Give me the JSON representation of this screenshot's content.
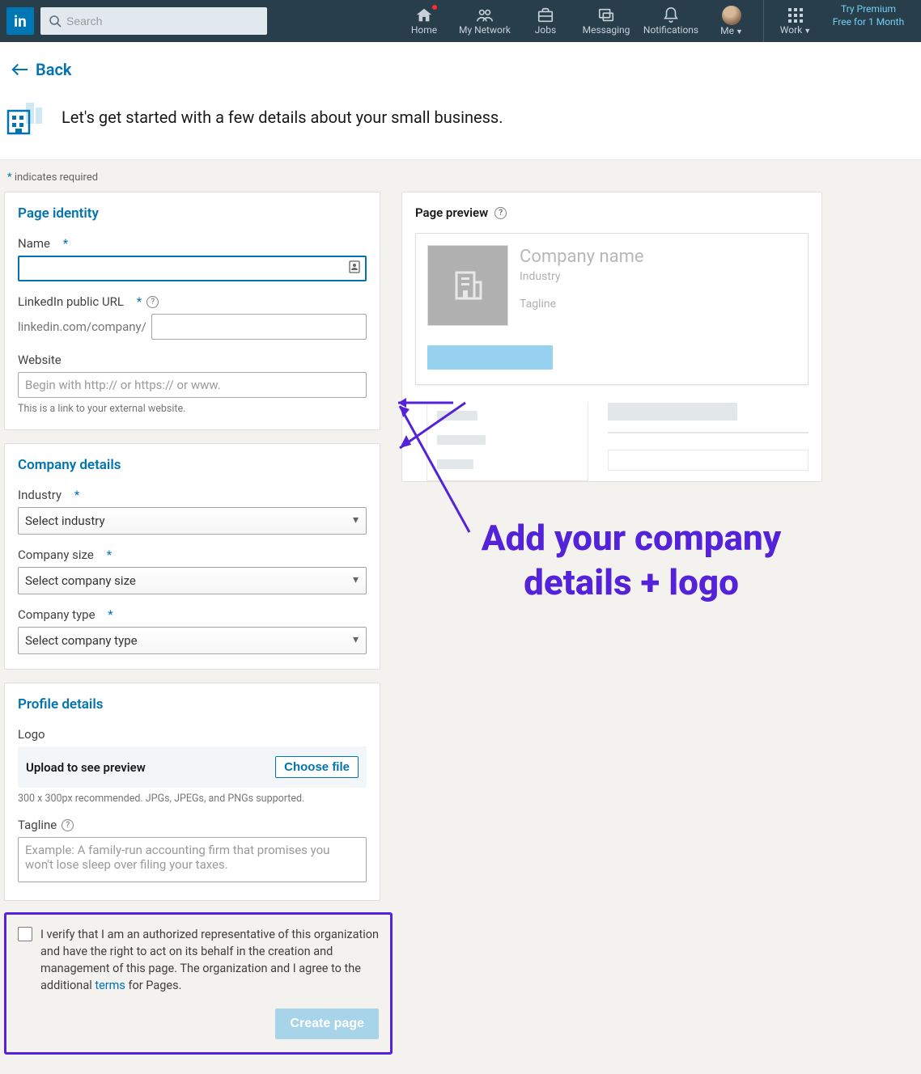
{
  "nav": {
    "logo_text": "in",
    "search_placeholder": "Search",
    "items": {
      "home": "Home",
      "network": "My Network",
      "jobs": "Jobs",
      "messaging": "Messaging",
      "notifications": "Notifications",
      "me": "Me",
      "work": "Work"
    },
    "premium_line1": "Try Premium",
    "premium_line2": "Free for 1 Month"
  },
  "back_label": "Back",
  "intro_text": "Let's get started with a few details about your small business.",
  "required_note": "indicates required",
  "required_mark": "*",
  "sections": {
    "identity": {
      "title": "Page identity",
      "name_label": "Name",
      "url_label": "LinkedIn public URL",
      "url_prefix": "linkedin.com/company/",
      "website_label": "Website",
      "website_placeholder": "Begin with http:// or https:// or www.",
      "website_help": "This is a link to your external website."
    },
    "company": {
      "title": "Company details",
      "industry_label": "Industry",
      "industry_placeholder": "Select industry",
      "size_label": "Company size",
      "size_placeholder": "Select company size",
      "type_label": "Company type",
      "type_placeholder": "Select company type"
    },
    "profile": {
      "title": "Profile details",
      "logo_label": "Logo",
      "upload_text": "Upload to see preview",
      "choose_label": "Choose file",
      "logo_help": "300 x 300px recommended. JPGs, JPEGs, and PNGs supported.",
      "tagline_label": "Tagline",
      "tagline_placeholder": "Example: A family-run accounting firm that promises you won't lose sleep over filing your taxes."
    }
  },
  "preview": {
    "title": "Page preview",
    "company_name": "Company name",
    "industry": "Industry",
    "tagline": "Tagline"
  },
  "annotation": {
    "text": "Add your company details + logo"
  },
  "verify": {
    "text_before": "I verify that I am an authorized representative of this organization and have the right to act on its behalf in the creation and management of this page. The organization and I agree to the additional ",
    "link": "terms",
    "text_after": " for Pages.",
    "create_label": "Create page"
  }
}
